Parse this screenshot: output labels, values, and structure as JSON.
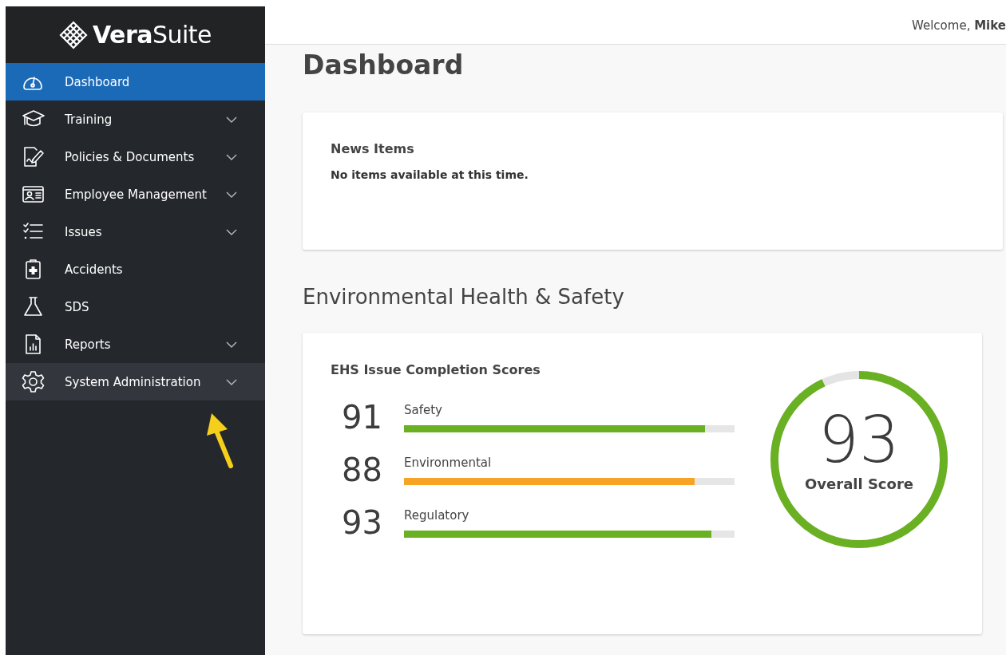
{
  "sidebar": {
    "logo": {
      "bold": "Vera",
      "light": "Suite"
    },
    "items": [
      {
        "label": "Dashboard",
        "selected": true,
        "hovered": false,
        "expandable": false
      },
      {
        "label": "Training",
        "selected": false,
        "hovered": false,
        "expandable": true
      },
      {
        "label": "Policies & Documents",
        "selected": false,
        "hovered": false,
        "expandable": true
      },
      {
        "label": "Employee Management",
        "selected": false,
        "hovered": false,
        "expandable": true
      },
      {
        "label": "Issues",
        "selected": false,
        "hovered": false,
        "expandable": true
      },
      {
        "label": "Accidents",
        "selected": false,
        "hovered": false,
        "expandable": false
      },
      {
        "label": "SDS",
        "selected": false,
        "hovered": false,
        "expandable": false
      },
      {
        "label": "Reports",
        "selected": false,
        "hovered": false,
        "expandable": true
      },
      {
        "label": "System Administration",
        "selected": false,
        "hovered": true,
        "expandable": true
      }
    ]
  },
  "header": {
    "welcome": "Welcome,",
    "user": "Mike"
  },
  "page_title": "Dashboard",
  "news": {
    "title": "News Items",
    "message": "No items available at this time."
  },
  "section_title": "Environmental Health & Safety",
  "ehs": {
    "title": "EHS Issue Completion Scores",
    "scores": [
      {
        "value": "91",
        "label": "Safety",
        "level": 0.91,
        "color": "#6ab023"
      },
      {
        "value": "88",
        "label": "Environmental",
        "level": 0.88,
        "color": "#f7a325"
      },
      {
        "value": "93",
        "label": "Regulatory",
        "level": 0.93,
        "color": "#6ab023"
      }
    ],
    "overall": {
      "value": "93",
      "label": "Overall Score",
      "level": 0.93
    }
  }
}
